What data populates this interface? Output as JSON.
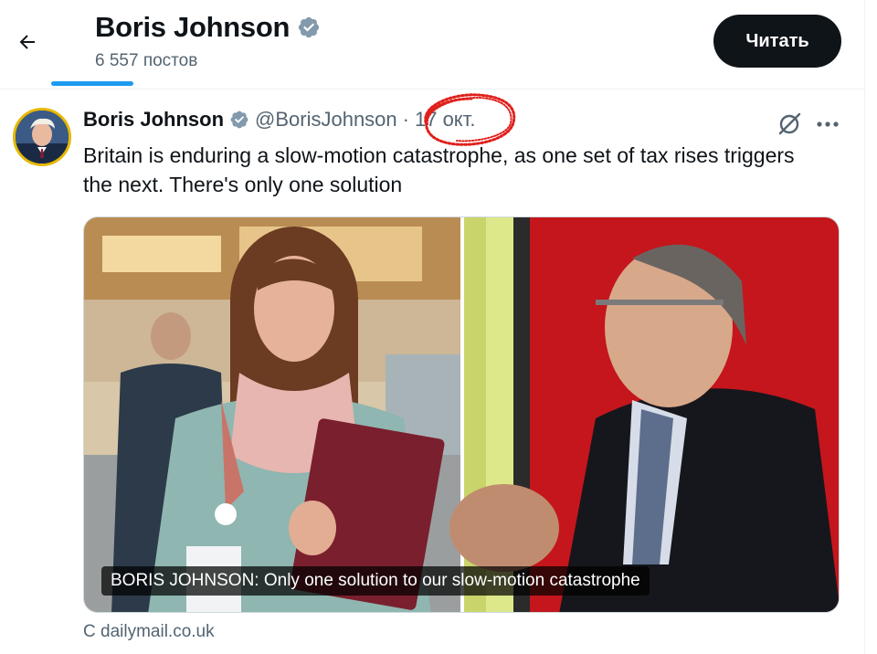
{
  "header": {
    "name": "Boris Johnson",
    "post_count": "6 557 постов",
    "read_button": "Читать"
  },
  "tweet": {
    "author_name": "Boris Johnson",
    "handle": "@BorisJohnson",
    "separator": "·",
    "date": "17 окт.",
    "text": "Britain is enduring a slow-motion catastrophe, as one set of tax rises triggers the next. There's only one solution"
  },
  "card": {
    "caption": "BORIS JOHNSON: Only one solution to our slow-motion catastrophe",
    "source": "С dailymail.co.uk"
  },
  "icons": {
    "back": "arrow-left-icon",
    "verified": "verified-badge-icon",
    "grok": "grok-icon",
    "more": "more-horizontal-icon"
  },
  "colors": {
    "accent": "#1d9bf0",
    "annotation_circle": "#e0201b",
    "text_primary": "#0f1419",
    "text_secondary": "#536471"
  }
}
